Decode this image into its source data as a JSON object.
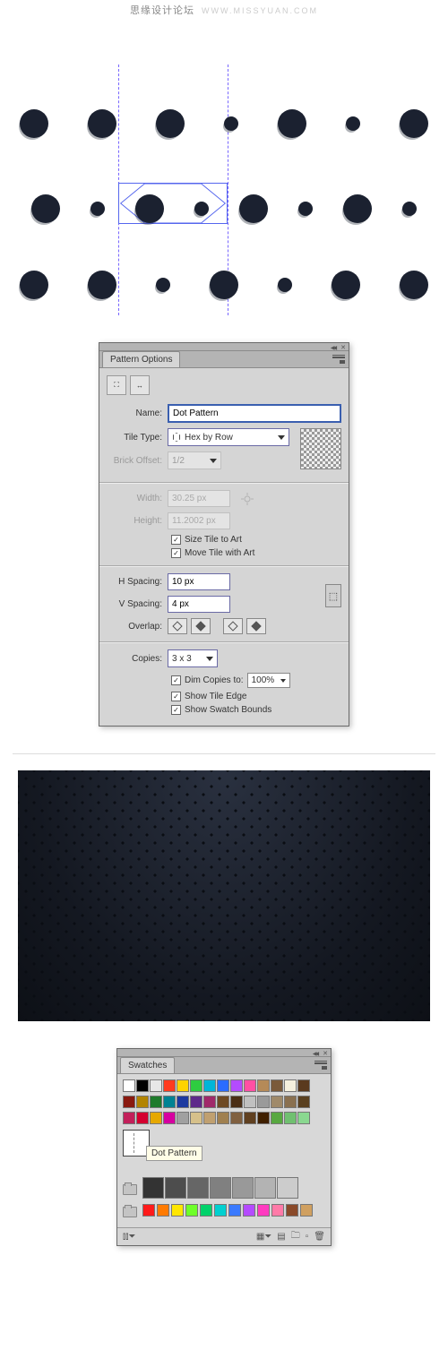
{
  "watermark": {
    "main": "思缘设计论坛",
    "sub": "WWW.MISSYUAN.COM"
  },
  "pattern_panel": {
    "title": "Pattern Options",
    "name_label": "Name:",
    "name_value": "Dot Pattern",
    "tile_type_label": "Tile Type:",
    "tile_type_value": "Hex by Row",
    "brick_offset_label": "Brick Offset:",
    "brick_offset_value": "1/2",
    "width_label": "Width:",
    "width_value": "30.25 px",
    "height_label": "Height:",
    "height_value": "11.2002 px",
    "size_tile": "Size Tile to Art",
    "move_tile": "Move Tile with Art",
    "h_spacing_label": "H Spacing:",
    "h_spacing_value": "10 px",
    "v_spacing_label": "V Spacing:",
    "v_spacing_value": "4 px",
    "overlap_label": "Overlap:",
    "copies_label": "Copies:",
    "copies_value": "3 x 3",
    "dim_copies": "Dim Copies to:",
    "dim_value": "100%",
    "show_tile_edge": "Show Tile Edge",
    "show_swatch_bounds": "Show Swatch Bounds"
  },
  "swatches_panel": {
    "title": "Swatches",
    "tooltip": "Dot Pattern"
  },
  "swatch_colors_r1": [
    "#ffffff",
    "#000000",
    "#e7e7e7",
    "#ff3b1f",
    "#ffd400",
    "#2ecc40",
    "#00b5d8",
    "#2b6cff",
    "#b44bff",
    "#ff4fa3",
    "#b58a58",
    "#7a5a3a",
    "#f5f0de",
    "#5a3a1e"
  ],
  "swatch_colors_r2": [
    "#8a1a10",
    "#b28400",
    "#1e7a2b",
    "#008293",
    "#1d3aa0",
    "#5e2a8a",
    "#a02a6a",
    "#6e4a24",
    "#4a2e15",
    "#c0c0c0",
    "#9a9a9a",
    "#a08a6a",
    "#8a7050",
    "#5a4020"
  ],
  "swatch_colors_r3": [
    "#c2205a",
    "#d40030",
    "#e6a800",
    "#d600a0",
    "#a0a0a0",
    "#d6c08a",
    "#c0a070",
    "#a08050",
    "#806040",
    "#604020",
    "#402000",
    "#58a840",
    "#70c070",
    "#8ad890"
  ],
  "gray_swatches": [
    "#333333",
    "#4d4d4d",
    "#666666",
    "#808080",
    "#999999",
    "#b3b3b3",
    "#cccccc"
  ],
  "bright_swatches": [
    "#ff1a1a",
    "#ff7a00",
    "#ffe600",
    "#6eff2a",
    "#00d26a",
    "#00d0d0",
    "#3a7aff",
    "#b44bff",
    "#ff3ac0",
    "#ff7aa8",
    "#8a4a2a",
    "#d0a060"
  ]
}
